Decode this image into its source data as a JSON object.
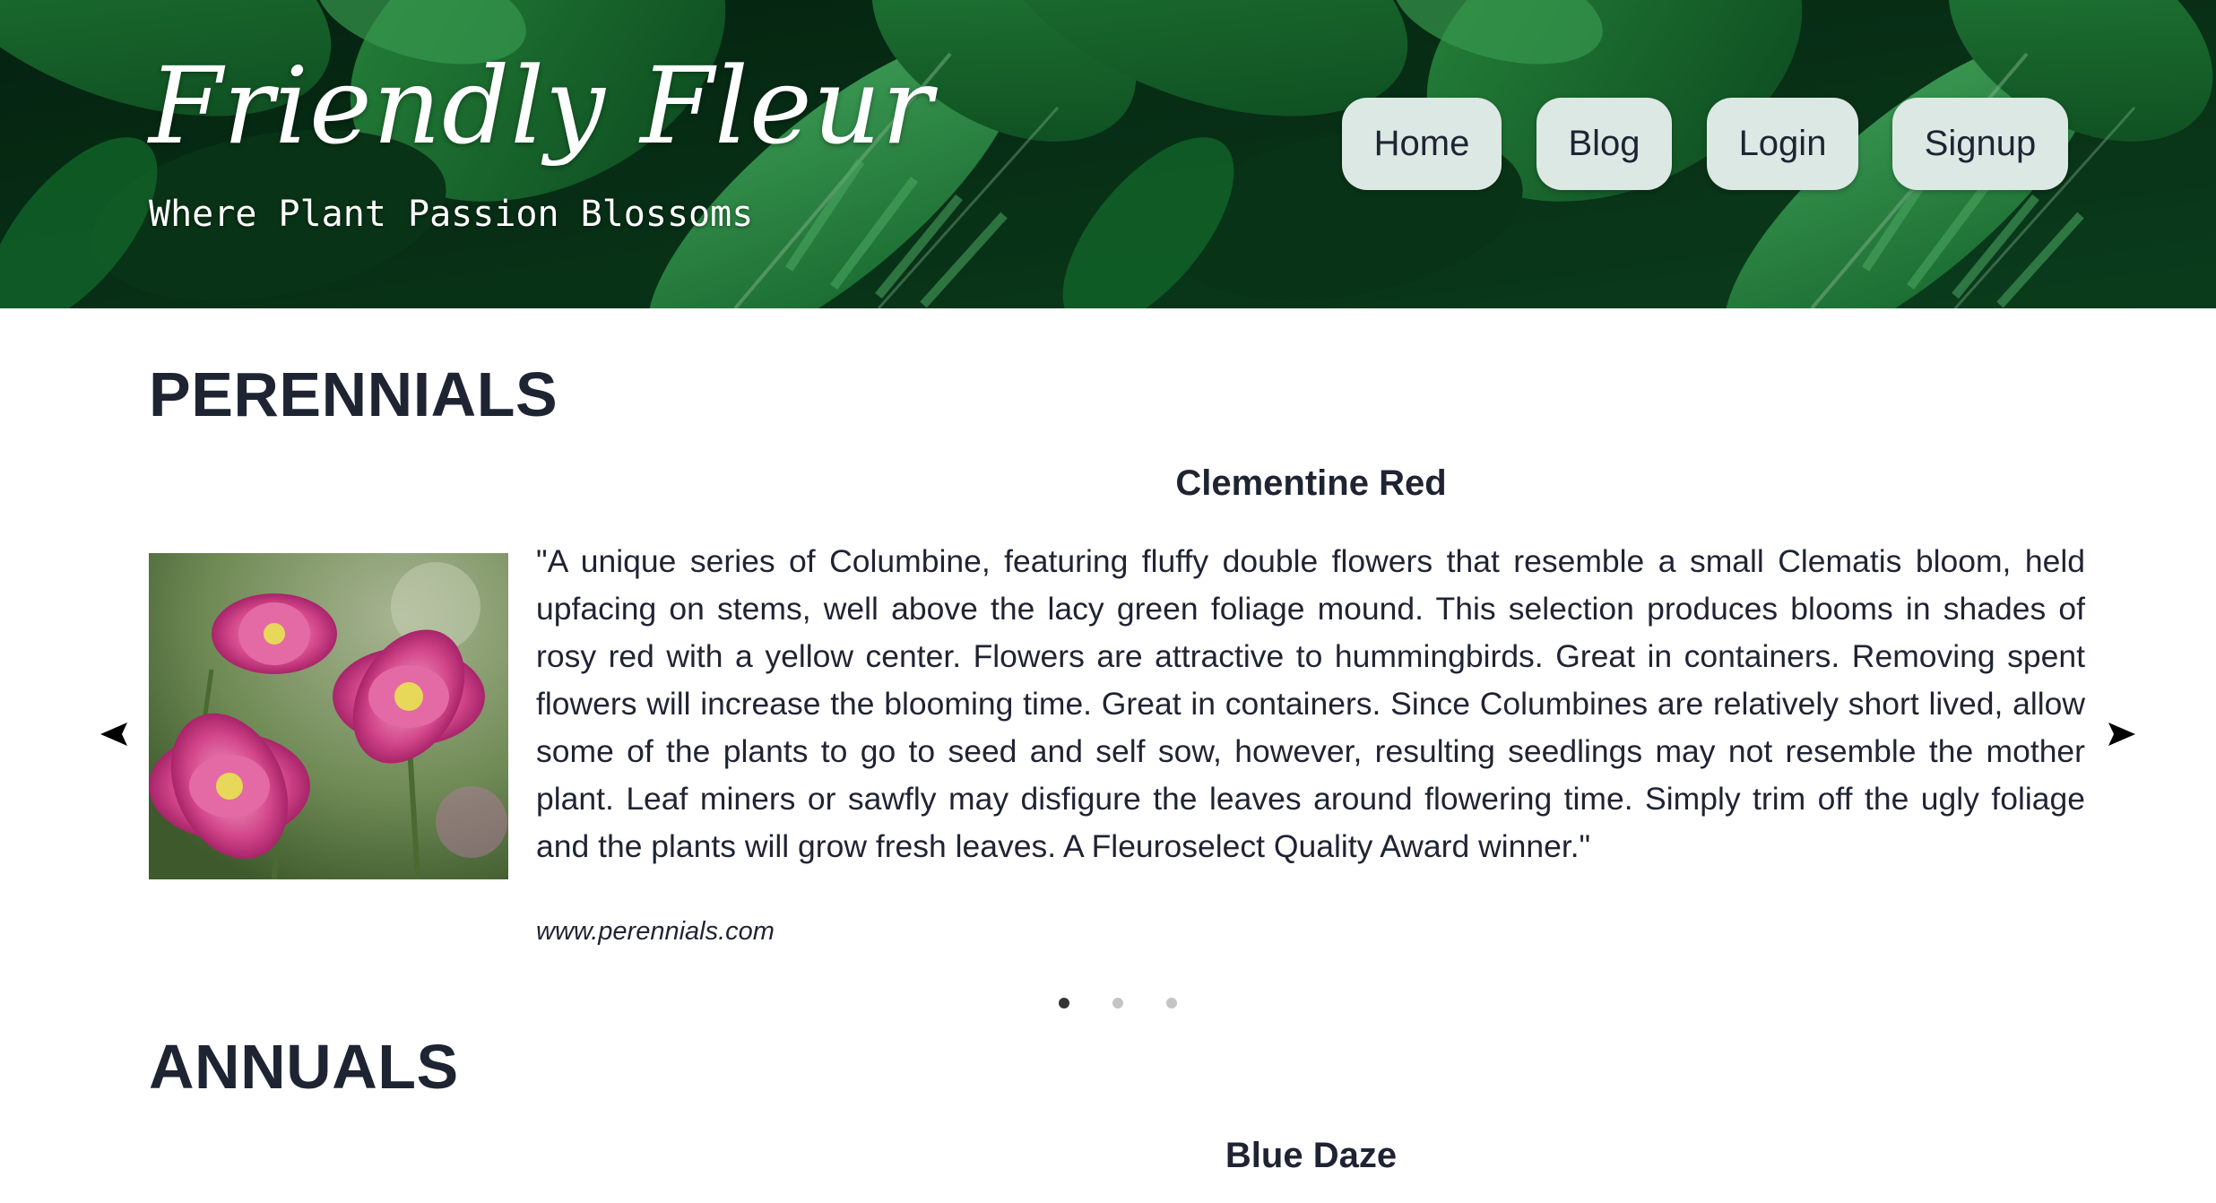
{
  "header": {
    "brand": "Friendly Fleur",
    "tagline": "Where Plant Passion Blossoms",
    "nav": [
      "Home",
      "Blog",
      "Login",
      "Signup"
    ]
  },
  "sections": [
    {
      "heading": "PERENNIALS",
      "slide": {
        "title": "Clementine Red",
        "description": "\"A unique series of Columbine, featuring fluffy double flowers that resemble a small Clematis bloom, held upfacing on stems, well above the lacy green foliage mound. This selection produces blooms in shades of rosy red with a yellow center. Flowers are attractive to hummingbirds. Great in containers. Removing spent flowers will increase the blooming time. Great in containers. Since Columbines are relatively short lived, allow some of the plants to go to seed and self sow, however, resulting seedlings may not resemble the mother plant. Leaf miners or sawfly may disfigure the leaves around flowering time. Simply trim off the ugly foliage and the plants will grow fresh leaves. A Fleuroselect Quality Award winner.\"",
        "source": "www.perennials.com",
        "image_icon": "pink-columbine-flower-photo"
      },
      "carousel": {
        "active_index": 1,
        "total": 3
      }
    },
    {
      "heading": "ANNUALS",
      "slide": {
        "title": "Blue Daze"
      }
    }
  ],
  "icons": {
    "prev": "triangle-left-icon",
    "next": "triangle-right-icon"
  },
  "colors": {
    "nav_button_bg": "#dce8e4",
    "text": "#1f2433",
    "dot_active": "#333333",
    "dot_inactive": "#c4c4c4"
  }
}
